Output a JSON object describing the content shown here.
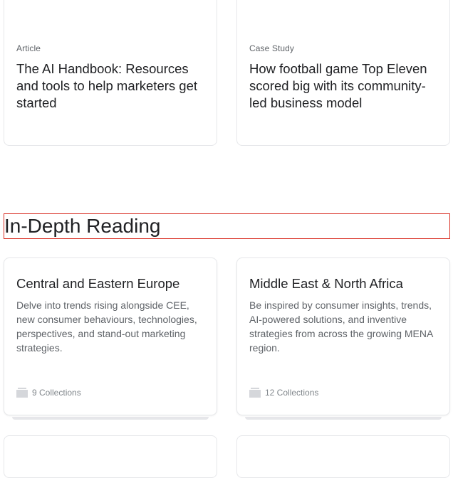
{
  "top_cards": [
    {
      "eyebrow": "Article",
      "title": "The AI Handbook: Resources and tools to help marketers get started"
    },
    {
      "eyebrow": "Case Study",
      "title": "How football game Top Eleven scored big with its community-led business model"
    }
  ],
  "section": {
    "title": "In-Depth Reading"
  },
  "collections": [
    {
      "title": "Central and Eastern Europe",
      "description": "Delve into trends rising alongside CEE, new consumer behaviours, technologies, perspectives, and stand-out marketing strategies.",
      "count": "9 Collections",
      "icon": "folder-icon"
    },
    {
      "title": "Middle East & North Africa",
      "description": "Be inspired by consumer insights, trends, AI-powered solutions, and inventive strategies from across the growing MENA region.",
      "count": "12 Collections",
      "icon": "folder-icon"
    }
  ],
  "colors": {
    "text": "#202124",
    "muted": "#5f6368",
    "border": "#e6e7ea",
    "highlight": "#d93025"
  }
}
